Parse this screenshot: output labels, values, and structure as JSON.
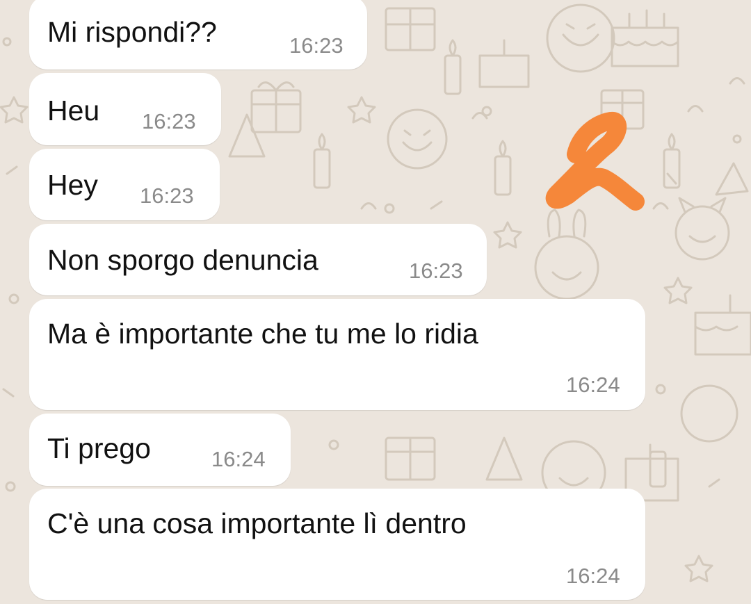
{
  "wallpaper": {
    "color": "#ece5dd",
    "doodle_color": "#d6ccc0",
    "theme": "birthday-doodles"
  },
  "messages": [
    {
      "text": "Mi rispondi??",
      "time": "16:23"
    },
    {
      "text": "Heu",
      "time": "16:23"
    },
    {
      "text": "Hey",
      "time": "16:23"
    },
    {
      "text": "Non sporgo denuncia",
      "time": "16:23"
    },
    {
      "text": "Ma è importante che tu me lo ridia",
      "time": "16:24"
    },
    {
      "text": "Ti prego",
      "time": "16:24"
    },
    {
      "text": "C'è una cosa importante lì dentro",
      "time": "16:24"
    }
  ],
  "annotation": {
    "color": "#f5873a",
    "shape": "hand-drawn-scribble"
  }
}
